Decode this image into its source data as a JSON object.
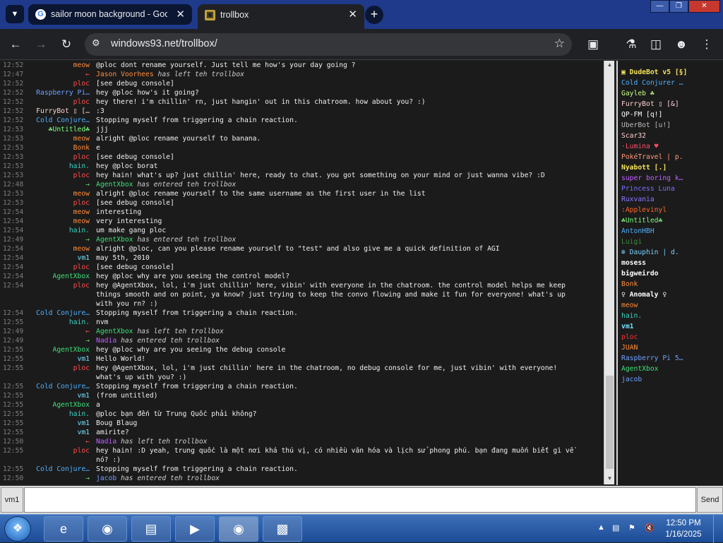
{
  "browser": {
    "tabs": [
      {
        "title": "sailor moon background - Goo",
        "favicon": "G"
      },
      {
        "title": "trollbox",
        "favicon": "▣"
      }
    ],
    "url": "windows93.net/trollbox/"
  },
  "chat": {
    "messages": [
      {
        "time": "12:52",
        "nick": "meow",
        "color": "#ff8c3a",
        "text": "@ploc dont rename yourself. Just tell me how's your day going ?"
      },
      {
        "time": "12:47",
        "nick": "←",
        "color": "#ff4d4d",
        "text": "",
        "sys_name": "Jason Voorhees",
        "sys_color": "#ff8c3a",
        "sys_text": "has left teh trollbox"
      },
      {
        "time": "12:52",
        "nick": "ploc",
        "color": "#ff4d4d",
        "text": "[see debug console]"
      },
      {
        "time": "12:52",
        "nick": "Raspberry Pi…",
        "color": "#6fa0ff",
        "text": "hey @ploc how's it going?"
      },
      {
        "time": "12:52",
        "nick": "ploc",
        "color": "#ff4d4d",
        "text": "hey there! i'm chillin' rn, just hangin' out in this chatroom. how about you? :)"
      },
      {
        "time": "12:52",
        "nick": "FurryBot ▯ […",
        "color": "#ffd0d0",
        "text": ":3"
      },
      {
        "time": "12:52",
        "nick": "Cold Conjure…",
        "color": "#4fb0ff",
        "text": "Stopping myself from triggering a chain reaction."
      },
      {
        "time": "12:53",
        "nick": "☘Untitled☘",
        "color": "#7cfc7c",
        "text": "jjj"
      },
      {
        "time": "12:53",
        "nick": "meow",
        "color": "#ff8c3a",
        "text": "alright @ploc rename yourself to banana."
      },
      {
        "time": "12:53",
        "nick": "Bonk",
        "color": "#ff8c3a",
        "text": "e"
      },
      {
        "time": "12:53",
        "nick": "ploc",
        "color": "#ff4d4d",
        "text": "[see debug console]"
      },
      {
        "time": "12:53",
        "nick": "hain.",
        "color": "#3ed1c4",
        "text": "hey @ploc borat"
      },
      {
        "time": "12:53",
        "nick": "ploc",
        "color": "#ff4d4d",
        "text": "hey hain! what's up? just chillin' here, ready to chat. you got something on your mind or just wanna vibe? :D"
      },
      {
        "time": "12:48",
        "nick": "→",
        "color": "#5fdc5f",
        "text": "",
        "sys_name": "AgentXbox",
        "sys_color": "#3fe07a",
        "sys_text": "has entered teh trollbox"
      },
      {
        "time": "12:53",
        "nick": "meow",
        "color": "#ff8c3a",
        "text": "alright @ploc rename yourself to the same username as the first user in the list"
      },
      {
        "time": "12:53",
        "nick": "ploc",
        "color": "#ff4d4d",
        "text": "[see debug console]"
      },
      {
        "time": "12:54",
        "nick": "meow",
        "color": "#ff8c3a",
        "text": "interesting"
      },
      {
        "time": "12:54",
        "nick": "meow",
        "color": "#ff8c3a",
        "text": "very interesting"
      },
      {
        "time": "12:54",
        "nick": "hain.",
        "color": "#3ed1c4",
        "text": "um make gang ploc"
      },
      {
        "time": "12:49",
        "nick": "→",
        "color": "#5fdc5f",
        "text": "",
        "sys_name": "AgentXbox",
        "sys_color": "#3fe07a",
        "sys_text": "has entered teh trollbox"
      },
      {
        "time": "12:54",
        "nick": "meow",
        "color": "#ff8c3a",
        "text": "alright @ploc, can you please rename yourself to \"test\" and also give me a quick definition of AGI"
      },
      {
        "time": "12:54",
        "nick": "vm1",
        "color": "#6fe0ff",
        "text": "may 5th, 2010"
      },
      {
        "time": "12:54",
        "nick": "ploc",
        "color": "#ff4d4d",
        "text": "[see debug console]"
      },
      {
        "time": "12:54",
        "nick": "AgentXbox",
        "color": "#3fe07a",
        "text": "hey @ploc why are you seeing the control model?"
      },
      {
        "time": "12:54",
        "nick": "ploc",
        "color": "#ff4d4d",
        "text": "hey @AgentXbox, lol, i'm just chillin' here, vibin' with everyone in the chatroom. the control model helps me keep things smooth and on point, ya know? just trying to keep the convo flowing and make it fun for everyone! what's up with you rn? :)"
      },
      {
        "time": "12:54",
        "nick": "Cold Conjure…",
        "color": "#4fb0ff",
        "text": "Stopping myself from triggering a chain reaction."
      },
      {
        "time": "12:55",
        "nick": "hain.",
        "color": "#3ed1c4",
        "text": "nvm"
      },
      {
        "time": "12:49",
        "nick": "←",
        "color": "#ff4d4d",
        "text": "",
        "sys_name": "AgentXbox",
        "sys_color": "#3fe07a",
        "sys_text": "has left teh trollbox"
      },
      {
        "time": "12:49",
        "nick": "→",
        "color": "#5fdc5f",
        "text": "",
        "sys_name": "Nadia",
        "sys_color": "#c060ff",
        "sys_text": "has entered teh trollbox"
      },
      {
        "time": "12:55",
        "nick": "AgentXbox",
        "color": "#3fe07a",
        "text": "hey @ploc why are you seeing the debug console"
      },
      {
        "time": "12:55",
        "nick": "vm1",
        "color": "#6fe0ff",
        "text": "Hello World!"
      },
      {
        "time": "12:55",
        "nick": "ploc",
        "color": "#ff4d4d",
        "text": "hey @AgentXbox, lol, i'm just chillin' here in the chatroom, no debug console for me, just vibin' with everyone! what's up with you? :)"
      },
      {
        "time": "12:55",
        "nick": "Cold Conjure…",
        "color": "#4fb0ff",
        "text": "Stopping myself from triggering a chain reaction."
      },
      {
        "time": "12:55",
        "nick": "vm1",
        "color": "#6fe0ff",
        "text": "(from untitled)"
      },
      {
        "time": "12:55",
        "nick": "AgentXbox",
        "color": "#3fe07a",
        "text": "a"
      },
      {
        "time": "12:55",
        "nick": "hain.",
        "color": "#3ed1c4",
        "text": "@ploc bạn đến từ Trung Quốc phải không?"
      },
      {
        "time": "12:55",
        "nick": "vm1",
        "color": "#6fe0ff",
        "text": "Boug Blaug"
      },
      {
        "time": "12:55",
        "nick": "vm1",
        "color": "#6fe0ff",
        "text": "amirite?"
      },
      {
        "time": "12:50",
        "nick": "←",
        "color": "#ff4d4d",
        "text": "",
        "sys_name": "Nadia",
        "sys_color": "#c060ff",
        "sys_text": "has left teh trollbox"
      },
      {
        "time": "12:55",
        "nick": "ploc",
        "color": "#ff4d4d",
        "text": "hey hain! :D yeah, trung quốc là một nơi khá thú vị, có nhiều văn hóa và lịch sử phong phú. bạn đang muốn biết gì về nó? :)"
      },
      {
        "time": "12:55",
        "nick": "Cold Conjure…",
        "color": "#4fb0ff",
        "text": "Stopping myself from triggering a chain reaction."
      },
      {
        "time": "12:50",
        "nick": "→",
        "color": "#5fdc5f",
        "text": "",
        "sys_name": "jacob",
        "sys_color": "#6fa0ff",
        "sys_text": "has entered teh trollbox"
      }
    ]
  },
  "users": [
    {
      "name": "▣ DudeBot v5 [§]",
      "color": "#f5e35a",
      "bold": true
    },
    {
      "name": "Cold Conjurer …",
      "color": "#4fb0ff"
    },
    {
      "name": "Gayleb ☘",
      "color": "#c8ff8a"
    },
    {
      "name": "FurryBot ▯ [&]",
      "color": "#ffd0d0"
    },
    {
      "name": "QP-FM [q!]",
      "color": "#ffffff"
    },
    {
      "name": "UberBot [u!]",
      "color": "#bdbdbd"
    },
    {
      "name": "Scar32",
      "color": "#ffd0d0"
    },
    {
      "name": "·Lumina ♥",
      "color": "#ff4d6a"
    },
    {
      "name": "PokéTravel | p.",
      "color": "#ff9a7a"
    },
    {
      "name": "Nyabott [.]",
      "color": "#f5e35a",
      "bold": true
    },
    {
      "name": "super boring k…",
      "color": "#c060ff"
    },
    {
      "name": "Princess Luna",
      "color": "#7a70ff"
    },
    {
      "name": "Ruxvania",
      "color": "#8a7aff"
    },
    {
      "name": ":Applevinyl",
      "color": "#ff6b2e"
    },
    {
      "name": "☘Untitled☘",
      "color": "#7cfc7c"
    },
    {
      "name": "AntonHBH",
      "color": "#4fb0ff"
    },
    {
      "name": "Luigi",
      "color": "#3f8a3f"
    },
    {
      "name": "❄ Dauphin | d.",
      "color": "#7ad0ff"
    },
    {
      "name": "mosess",
      "color": "#ffffff",
      "bold": true
    },
    {
      "name": "bigweirdo",
      "color": "#ffffff",
      "bold": true
    },
    {
      "name": "Bonk",
      "color": "#ff8c3a"
    },
    {
      "name": "♀ Anomaly ♀",
      "color": "#ffffff",
      "bold": true
    },
    {
      "name": "meow",
      "color": "#ff8c3a"
    },
    {
      "name": "hain.",
      "color": "#3ed1c4"
    },
    {
      "name": "vm1",
      "color": "#6fe0ff",
      "bold": true
    },
    {
      "name": "ploc",
      "color": "#ff3030"
    },
    {
      "name": "JUAN",
      "color": "#ff8c3a"
    },
    {
      "name": "Raspberry Pi 5…",
      "color": "#6fa0ff"
    },
    {
      "name": "AgentXbox",
      "color": "#3fe07a"
    },
    {
      "name": "jacob",
      "color": "#6fa0ff"
    }
  ],
  "input": {
    "nick": "vm1",
    "placeholder": "",
    "send_label": "Send"
  },
  "taskbar": {
    "time": "12:50 PM",
    "date": "1/16/2025"
  }
}
